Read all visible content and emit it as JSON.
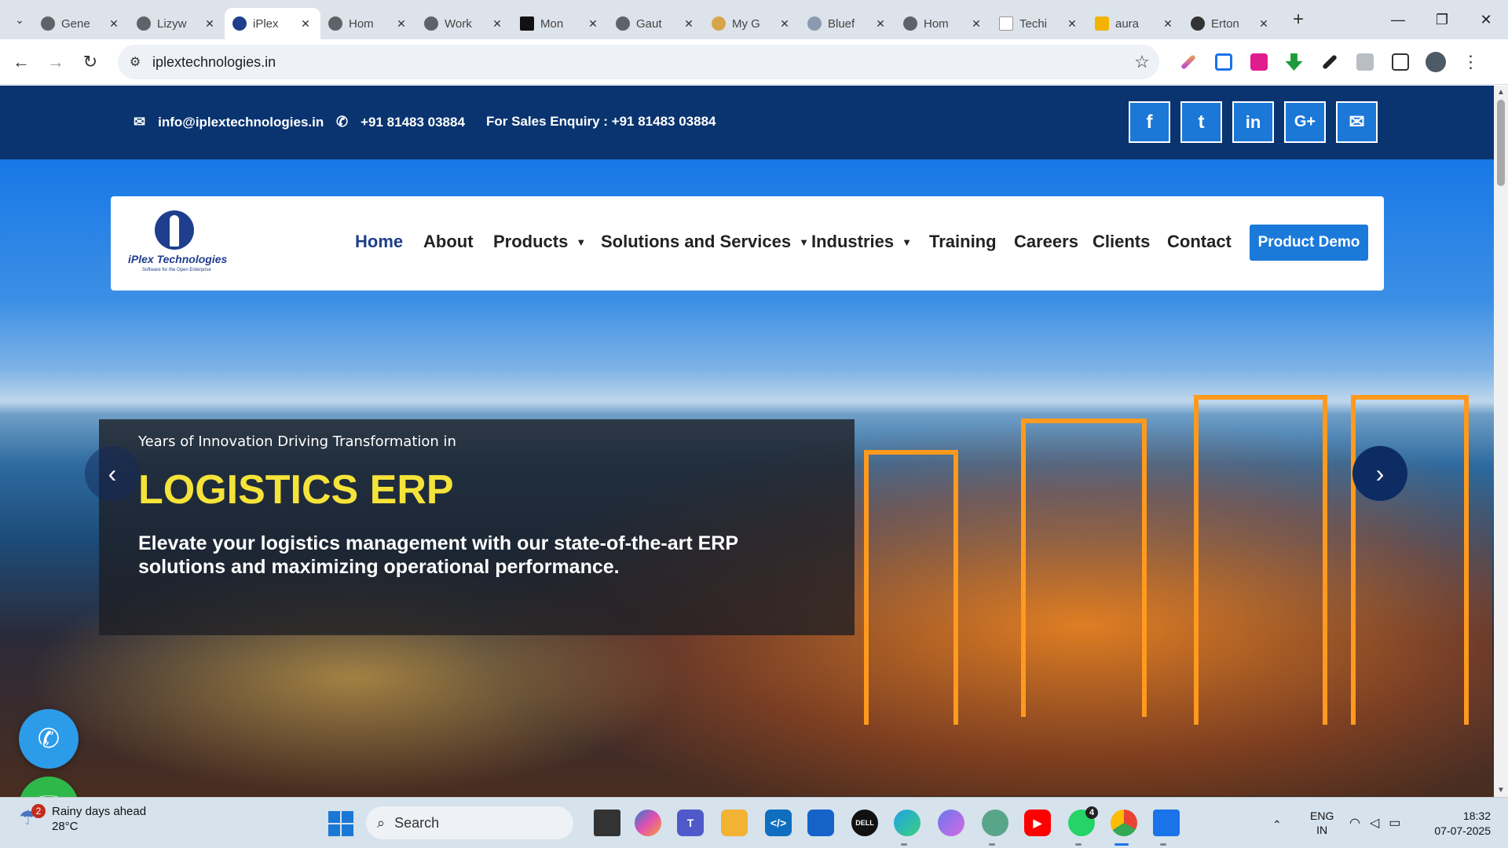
{
  "browser": {
    "tabs": [
      {
        "title": "Gene",
        "active": false
      },
      {
        "title": "Lizyw",
        "active": false
      },
      {
        "title": "iPlex",
        "active": true
      },
      {
        "title": "Hom",
        "active": false
      },
      {
        "title": "Work",
        "active": false
      },
      {
        "title": "Mon",
        "active": false
      },
      {
        "title": "Gaut",
        "active": false
      },
      {
        "title": "My G",
        "active": false
      },
      {
        "title": "Bluef",
        "active": false
      },
      {
        "title": "Hom",
        "active": false
      },
      {
        "title": "Techi",
        "active": false
      },
      {
        "title": "aura",
        "active": false
      },
      {
        "title": "Erton",
        "active": false
      }
    ],
    "url": "iplextechnologies.in"
  },
  "site": {
    "topbar": {
      "email": "info@iplextechnologies.in",
      "phone": "+91 81483 03884",
      "sales": "For Sales Enquiry : +91 81483 03884",
      "social": [
        {
          "label": "f",
          "icon": "facebook-icon"
        },
        {
          "label": "t",
          "icon": "twitter-icon"
        },
        {
          "label": "in",
          "icon": "linkedin-icon"
        },
        {
          "label": "G+",
          "icon": "google-plus-icon"
        },
        {
          "label": "✉",
          "icon": "mail-icon"
        }
      ]
    },
    "logo": {
      "name": "iPlex Technologies",
      "tagline": "Software for the Open Enterprise"
    },
    "nav": {
      "home": "Home",
      "about": "About",
      "products": "Products",
      "solutions": "Solutions and Services",
      "industries": "Industries",
      "training": "Training",
      "careers": "Careers",
      "clients": "Clients",
      "contact": "Contact",
      "demo": "Product Demo"
    },
    "hero": {
      "subtitle": "Years of Innovation Driving Transformation in",
      "title": "LOGISTICS ERP",
      "description": "Elevate your logistics management with our state-of-the-art ERP solutions and maximizing operational performance."
    }
  },
  "taskbar": {
    "weather": {
      "text": "Rainy days ahead",
      "temp": "28°C",
      "badge": "2"
    },
    "search": "Search",
    "lang": {
      "line1": "ENG",
      "line2": "IN"
    },
    "time": "18:32",
    "date": "07-07-2025",
    "whatsapp_badge": "4"
  },
  "colors": {
    "topbar": "#0a3470",
    "accent": "#1b7ad9",
    "hero_title": "#f6e33a"
  }
}
